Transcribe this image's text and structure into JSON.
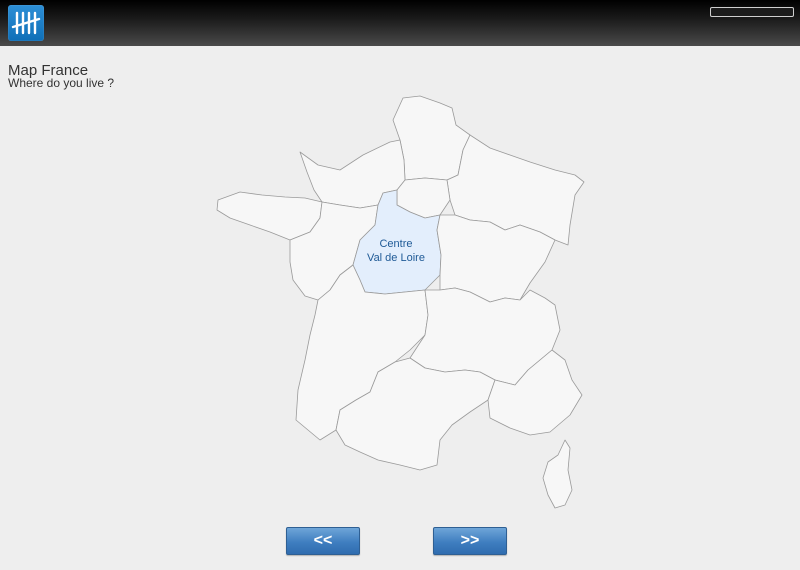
{
  "header": {
    "logo_icon": "tally-marks-icon",
    "progress_percent": 0,
    "brand_color": "#1379c4"
  },
  "page": {
    "title": "Map France",
    "subtitle": "Where do you live ?"
  },
  "map": {
    "selected_region": "centre",
    "selected_fill": "#e3eefc",
    "default_fill": "#f7f7f7",
    "label_line1": "Centre",
    "label_line2": "Val de Loire"
  },
  "navigation": {
    "prev_label": "<<",
    "next_label": ">>"
  }
}
